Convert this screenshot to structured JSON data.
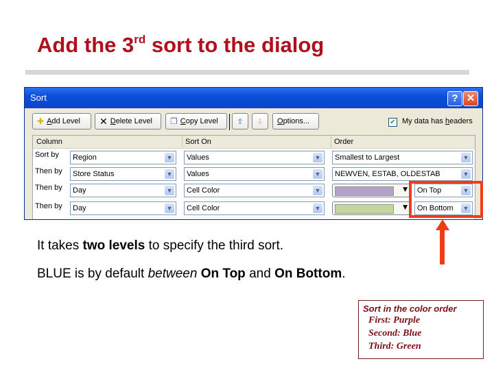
{
  "slide": {
    "title_prefix": "Add the 3",
    "title_sup": "rd",
    "title_suffix": " sort to the dialog",
    "body_line1": {
      "pre": "It takes ",
      "bold": "two levels",
      "post": " to specify the third sort."
    },
    "body_line2": {
      "pre": "BLUE is by default ",
      "italic": "between",
      "mid1": " ",
      "bold1": "On Top",
      "mid2": " and ",
      "bold2": "On Bottom",
      "post": "."
    },
    "note": {
      "heading": "Sort in the color order",
      "lines": [
        "First: Purple",
        "Second: Blue",
        "Third: Green"
      ]
    },
    "highlight_color": "#f03c18"
  },
  "dialog": {
    "title": "Sort",
    "help_label": "?",
    "close_label": "✕",
    "toolbar": {
      "add_level": {
        "u": "A",
        "rest": "dd Level"
      },
      "delete_level": {
        "u": "D",
        "rest": "elete Level"
      },
      "copy_level": {
        "u": "C",
        "rest": "opy Level"
      },
      "move_up": "⇧",
      "move_down": "⇩",
      "options": {
        "u": "O",
        "rest": "ptions..."
      }
    },
    "headers_checkbox": {
      "checked": true,
      "label_pre": "My data has ",
      "label_u": "h",
      "label_post": "eaders"
    },
    "columns": {
      "column": "Column",
      "sort_on": "Sort On",
      "order": "Order"
    },
    "rows": [
      {
        "label": "Sort by",
        "column": "Region",
        "sort_on": "Values",
        "order": "Smallest to Largest"
      },
      {
        "label": "Then by",
        "column": "Store Status",
        "sort_on": "Values",
        "order": "NEWVEN, ESTAB, OLDESTAB"
      },
      {
        "label": "Then by",
        "column": "Day",
        "sort_on": "Cell Color",
        "order_color": "#b3a2c7",
        "position": "On Top"
      },
      {
        "label": "Then by",
        "column": "Day",
        "sort_on": "Cell Color",
        "order_color": "#c3d69b",
        "position": "On Bottom"
      }
    ]
  }
}
